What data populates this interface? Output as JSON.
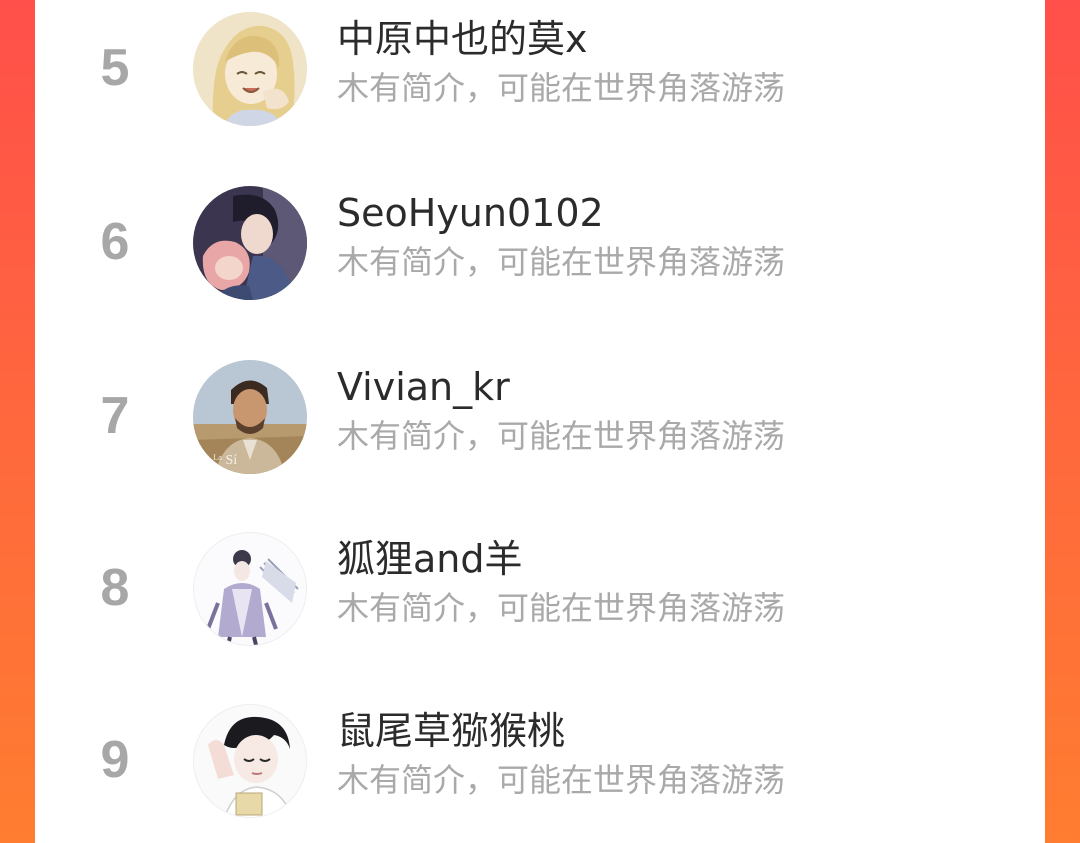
{
  "ranking": {
    "entries": [
      {
        "rank": "5",
        "name": "中原中也的莫x",
        "bio": "木有简介，可能在世界角落游荡"
      },
      {
        "rank": "6",
        "name": "SeoHyun0102",
        "bio": "木有简介，可能在世界角落游荡"
      },
      {
        "rank": "7",
        "name": "Vivian_kr",
        "bio": "木有简介，可能在世界角落游荡"
      },
      {
        "rank": "8",
        "name": "狐狸and羊",
        "bio": "木有简介，可能在世界角落游荡"
      },
      {
        "rank": "9",
        "name": "鼠尾草猕猴桃",
        "bio": "木有简介，可能在世界角落游荡"
      }
    ]
  },
  "colors": {
    "background_gradient_top": "#ff4f4a",
    "background_gradient_bottom": "#ff7d30",
    "panel": "#ffffff",
    "rank_text": "#a7a7a7",
    "name_text": "#2b2b2b",
    "bio_text": "#a9a9a9"
  }
}
